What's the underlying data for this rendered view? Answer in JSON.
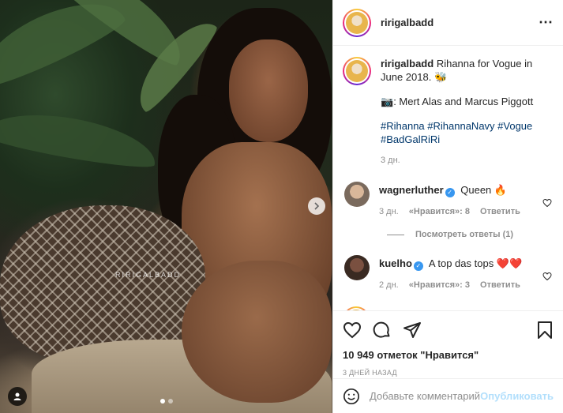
{
  "post": {
    "username": "ririgalbadd",
    "photo_watermark": "RIRIGALBADD"
  },
  "caption": {
    "username": "ririgalbadd",
    "text": "Rihanna for Vogue in June 2018.",
    "emoji": "🐝",
    "credit_emoji": "📷",
    "credit": ": Mert Alas and Marcus Piggott",
    "hashtags_line1": "#Rihanna #RihannaNavy #Vogue",
    "hashtags_line2": "#BadGalRiRi",
    "age": "3 дн."
  },
  "comments": [
    {
      "username": "wagnerluther",
      "text": "Queen",
      "emoji": "🔥",
      "age": "3 дн.",
      "likes": "«Нравится»: 8",
      "reply": "Ответить"
    },
    {
      "username": "kuelho",
      "text": "A top das tops",
      "emoji": "❤️❤️",
      "age": "2 дн.",
      "likes": "«Нравится»: 3",
      "reply": "Ответить"
    }
  ],
  "view_replies": "Посмотреть ответы (1)",
  "likes_count": "10 949 отметок \"Нравится\"",
  "timestamp": "3 ДНЕЙ НАЗАД",
  "add_comment": {
    "placeholder": "Добавьте комментарий...",
    "post_label": "Опубликовать"
  },
  "colors": {
    "link": "#00376b",
    "verified": "#3897f0",
    "muted": "#8e8e8e",
    "post_disabled": "#b2dffc",
    "heart_red": "#ed4956"
  },
  "icons": [
    "more-icon",
    "heart-icon",
    "comment-icon",
    "share-icon",
    "bookmark-icon",
    "emoji-icon",
    "chevron-right-icon",
    "user-tag-icon",
    "verified-icon"
  ]
}
